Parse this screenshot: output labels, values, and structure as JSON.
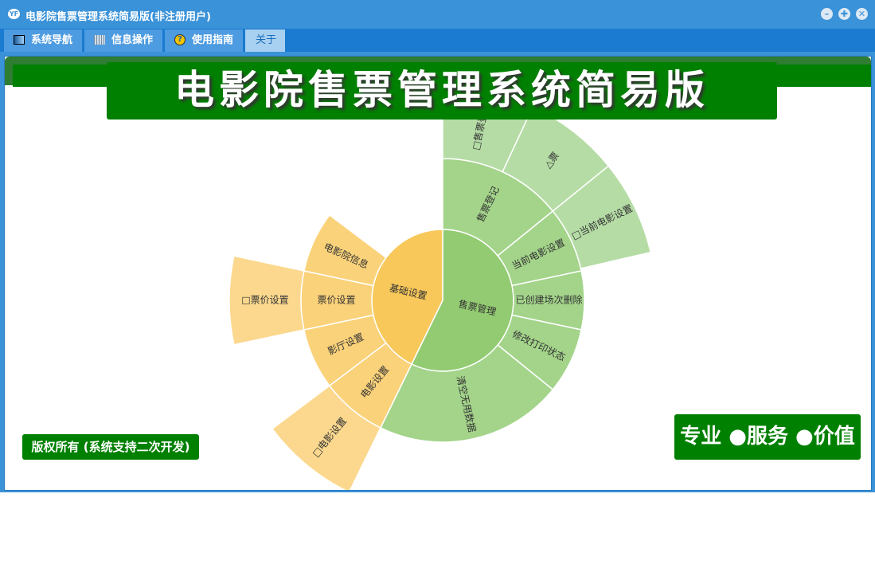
{
  "window": {
    "title": "电影院售票管理系统简易版(非注册用户)",
    "logo": "YF",
    "buttons": [
      "minimize",
      "maximize",
      "close"
    ]
  },
  "tabs": [
    {
      "label": "系统导航",
      "icon": "monitor-icon"
    },
    {
      "label": "信息操作",
      "icon": "grid-icon"
    },
    {
      "label": "使用指南",
      "icon": "help-icon"
    },
    {
      "label": "关于",
      "icon": ""
    }
  ],
  "banner": "电影院售票管理系统简易版",
  "copyright": "版权所有 (系统支持二次开发)",
  "slogan": "专业 ●服务 ●价值",
  "colors": {
    "green": [
      "#93cb72",
      "#a3d48a",
      "#b5dca5"
    ],
    "orange": [
      "#f8c85a",
      "#fad27a",
      "#fbd88e"
    ]
  },
  "chart_data": {
    "type": "sunburst",
    "nodes": [
      {
        "name": "售票管理",
        "level": 0,
        "group": "green",
        "start": 0,
        "end": 206
      },
      {
        "name": "基础设置",
        "level": 0,
        "group": "orange",
        "start": 206,
        "end": 360
      },
      {
        "name": "售票登记",
        "level": 1,
        "group": "green",
        "start": 0,
        "end": 51
      },
      {
        "name": "当前电影设置",
        "level": 1,
        "group": "green",
        "start": 51,
        "end": 78
      },
      {
        "name": "已创建场次删除",
        "level": 1,
        "group": "green",
        "start": 78,
        "end": 102
      },
      {
        "name": "修改打印状态",
        "level": 1,
        "group": "green",
        "start": 102,
        "end": 129
      },
      {
        "name": "清空无用数据",
        "level": 1,
        "group": "green",
        "start": 129,
        "end": 206
      },
      {
        "name": "电影设置",
        "level": 1,
        "group": "orange",
        "start": 206,
        "end": 233
      },
      {
        "name": "影厅设置",
        "level": 1,
        "group": "orange",
        "start": 233,
        "end": 258
      },
      {
        "name": "票价设置",
        "level": 1,
        "group": "orange",
        "start": 258,
        "end": 282
      },
      {
        "name": "电影院信息",
        "level": 1,
        "group": "orange",
        "start": 282,
        "end": 307
      },
      {
        "name": "□售票登记",
        "level": 2,
        "group": "green",
        "start": 0,
        "end": 25
      },
      {
        "name": "△票",
        "level": 2,
        "group": "green",
        "start": 25,
        "end": 51
      },
      {
        "name": "□当前电影设置",
        "level": 2,
        "group": "green",
        "start": 51,
        "end": 77
      },
      {
        "name": "□电影设置",
        "level": 2,
        "group": "orange",
        "start": 206,
        "end": 233
      },
      {
        "name": "□票价设置",
        "level": 2,
        "group": "orange",
        "start": 258,
        "end": 282
      }
    ]
  }
}
